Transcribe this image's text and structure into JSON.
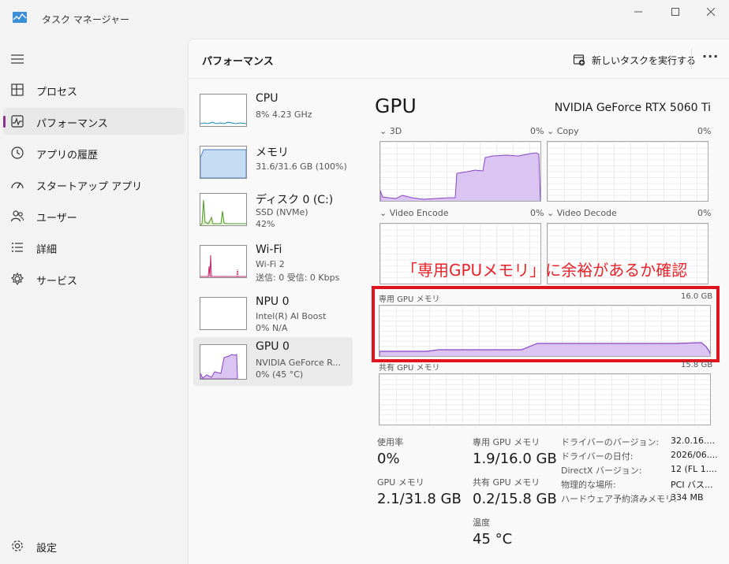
{
  "window": {
    "title": "タスク マネージャー"
  },
  "sidebar": {
    "items": [
      {
        "label": "プロセス",
        "icon": "processes-icon"
      },
      {
        "label": "パフォーマンス",
        "icon": "performance-icon"
      },
      {
        "label": "アプリの履歴",
        "icon": "history-icon"
      },
      {
        "label": "スタートアップ アプリ",
        "icon": "startup-icon"
      },
      {
        "label": "ユーザー",
        "icon": "users-icon"
      },
      {
        "label": "詳細",
        "icon": "details-icon"
      },
      {
        "label": "サービス",
        "icon": "services-icon"
      }
    ],
    "active_index": 1,
    "settings_label": "設定"
  },
  "header": {
    "title": "パフォーマンス",
    "run_task_label": "新しいタスクを実行する",
    "more_label": "···"
  },
  "devices": [
    {
      "name": "CPU",
      "lines": [
        "8%  4.23 GHz"
      ],
      "color": "#1d8ab8"
    },
    {
      "name": "メモリ",
      "lines": [
        "31.6/31.6 GB (100%)"
      ],
      "color": "#4a7fc4"
    },
    {
      "name": "ディスク 0 (C:)",
      "lines": [
        "SSD (NVMe)",
        "42%"
      ],
      "color": "#4e9a26"
    },
    {
      "name": "Wi-Fi",
      "lines": [
        "Wi-Fi 2",
        "送信: 0 受信: 0 Kbps"
      ],
      "color": "#c4266b"
    },
    {
      "name": "NPU 0",
      "lines": [
        "Intel(R) AI Boost",
        "0%  N/A"
      ],
      "color": "#888888"
    },
    {
      "name": "GPU 0",
      "lines": [
        "NVIDIA GeForce R...",
        "0%  (45 °C)"
      ],
      "color": "#8a44c7"
    }
  ],
  "gpu": {
    "title": "GPU",
    "model": "NVIDIA GeForce RTX 5060 Ti",
    "engines": [
      {
        "label": "3D",
        "pct": "0%"
      },
      {
        "label": "Copy",
        "pct": "0%"
      },
      {
        "label": "Video Encode",
        "pct": "0%"
      },
      {
        "label": "Video Decode",
        "pct": "0%"
      }
    ],
    "dedicated_label": "専用 GPU メモリ",
    "dedicated_max": "16.0 GB",
    "shared_label": "共有 GPU メモリ",
    "shared_max": "15.8 GB",
    "stats": {
      "usage_label": "使用率",
      "usage_value": "0%",
      "dedicated_label": "専用 GPU メモリ",
      "dedicated_value": "1.9/16.0 GB",
      "gpu_mem_label": "GPU メモリ",
      "gpu_mem_value": "2.1/31.8 GB",
      "shared_label": "共有 GPU メモリ",
      "shared_value": "0.2/15.8 GB",
      "temp_label": "温度",
      "temp_value": "45 °C"
    },
    "info": [
      {
        "key": "ドライバーのバージョン:",
        "value": "32.0.16...."
      },
      {
        "key": "ドライバーの日付:",
        "value": "2026/06...."
      },
      {
        "key": "DirectX バージョン:",
        "value": "12 (FL 1...."
      },
      {
        "key": "物理的な場所:",
        "value": "PCI バス..."
      },
      {
        "key": "ハードウェア予約済みメモリ:",
        "value": "334 MB"
      }
    ]
  },
  "annotation": "「専用GPUメモリ」に余裕があるか確認",
  "colors": {
    "gpu_line": "#8a44c7",
    "gpu_fill": "#d9c4f2",
    "annotation": "#e8232a"
  }
}
